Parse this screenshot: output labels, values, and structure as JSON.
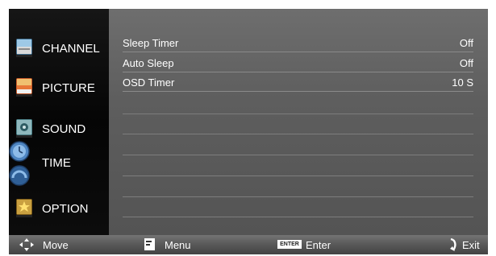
{
  "sidebar": {
    "items": [
      {
        "label": "CHANNEL",
        "icon": "channel-icon"
      },
      {
        "label": "PICTURE",
        "icon": "picture-icon"
      },
      {
        "label": "SOUND",
        "icon": "sound-icon"
      },
      {
        "label": "TIME",
        "icon": "clock-icon",
        "selected": true
      },
      {
        "label": "OPTION",
        "icon": "star-icon"
      }
    ]
  },
  "menu": {
    "rows": [
      {
        "name": "Sleep Timer",
        "value": "Off"
      },
      {
        "name": "Auto Sleep",
        "value": "Off"
      },
      {
        "name": "OSD Timer",
        "value": "10 S"
      }
    ]
  },
  "footer": {
    "move": {
      "label": "Move",
      "icon": "four-way-arrows-icon"
    },
    "menu": {
      "label": "Menu",
      "icon": "menu-icon"
    },
    "enter": {
      "label": "Enter",
      "badge": "ENTER",
      "icon": "enter-key-icon"
    },
    "exit": {
      "label": "Exit",
      "icon": "exit-icon"
    }
  },
  "colors": {
    "sidebar_bg": "#0a0a0a",
    "panel_bg": "#646464",
    "footer_bg": "#5a5a5a",
    "text": "#ffffff"
  }
}
